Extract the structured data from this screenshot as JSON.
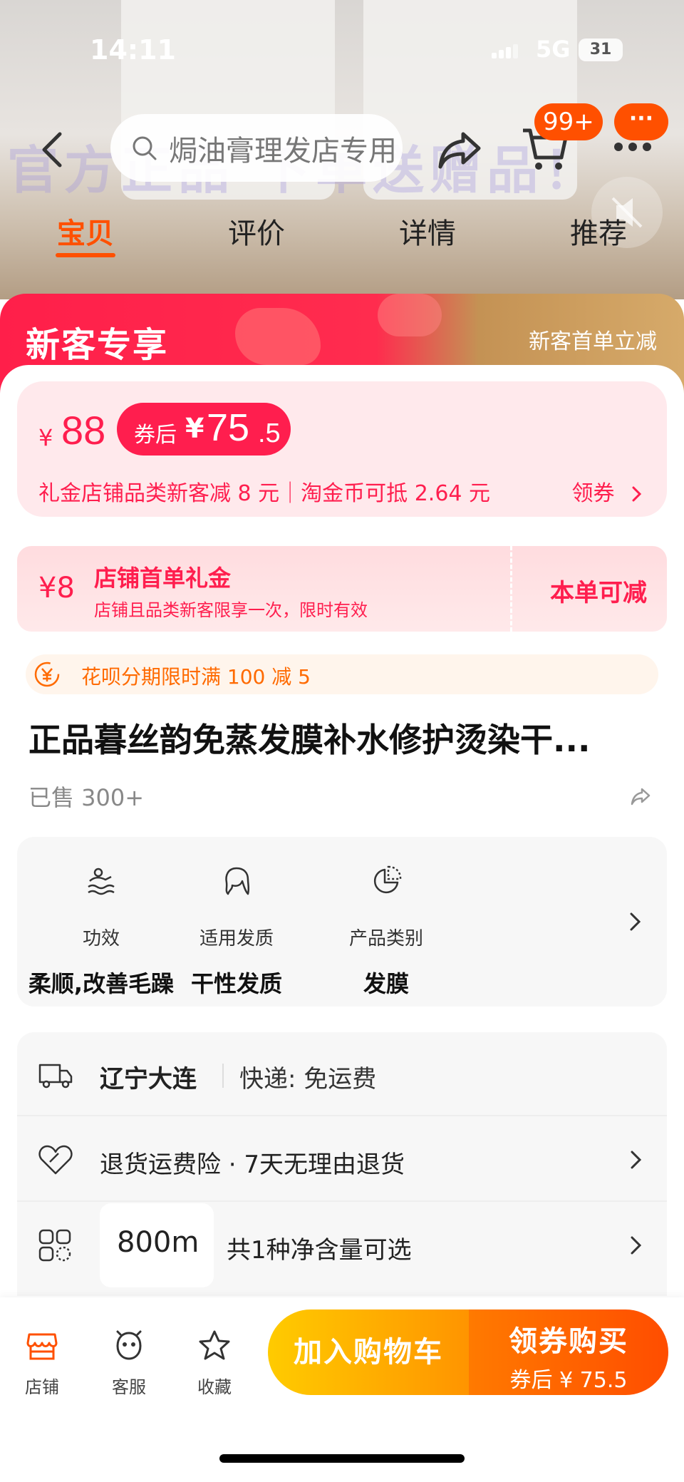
{
  "status_bar": {
    "time": "14:11",
    "network": "5G",
    "battery": "31"
  },
  "hero": {
    "banner_text": "官方正品  下单送赠品！"
  },
  "search": {
    "placeholder": "焗油膏理发店专用"
  },
  "cart": {
    "badge": "99+"
  },
  "more": {
    "label": "···"
  },
  "tabs": [
    {
      "label": "宝贝",
      "active": true
    },
    {
      "label": "评价",
      "active": false
    },
    {
      "label": "详情",
      "active": false
    },
    {
      "label": "推荐",
      "active": false
    }
  ],
  "promo": {
    "title": "新客专享",
    "right_text": "新客首单立减"
  },
  "price": {
    "currency": "¥",
    "original": "88",
    "coupon_label": "券后",
    "coupon_currency": "¥",
    "coupon_int": "75",
    "coupon_dec": ".5",
    "desc": "礼金店铺品类新客减 8 元｜淘金币可抵 2.64 元",
    "get_coupon": "领券"
  },
  "shop_coupon": {
    "amount": "¥8",
    "title": "店铺首单礼金",
    "subtitle": "店铺且品类新客限享一次，限时有效",
    "action": "本单可减"
  },
  "huabei": {
    "text": "花呗分期限时满 100 减 5"
  },
  "product": {
    "title": "正品暮丝韵免蒸发膜补水修护烫染干...",
    "sold": "已售 300+"
  },
  "attributes": [
    {
      "label": "功效",
      "value": "柔顺,改善毛躁",
      "icon": "swim-icon"
    },
    {
      "label": "适用发质",
      "value": "干性发质",
      "icon": "hair-icon"
    },
    {
      "label": "产品类别",
      "value": "发膜",
      "icon": "pie-icon"
    }
  ],
  "shipping": {
    "location": "辽宁大连",
    "method": "快递: 免运费"
  },
  "returns": {
    "text": "退货运费险 · 7天无理由退货"
  },
  "options": {
    "chip": "800m",
    "text": "共1种净含量可选"
  },
  "bottom_bar": {
    "shop": "店铺",
    "service": "客服",
    "favorite": "收藏",
    "add_cart": "加入购物车",
    "buy_title": "领券购买",
    "buy_sub": "券后 ¥ 75.5"
  },
  "colors": {
    "accent": "#ff5000",
    "price_red": "#ff1e4e",
    "cart_yellow": "#ffb400"
  }
}
